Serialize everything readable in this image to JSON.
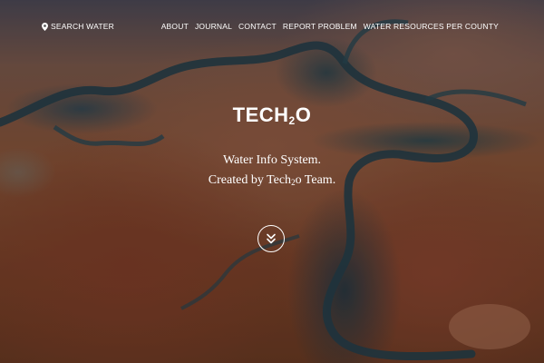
{
  "nav": {
    "search": {
      "icon": "location-pin-icon",
      "label": "SEARCH WATER"
    },
    "menu": [
      {
        "label": "ABOUT"
      },
      {
        "label": "JOURNAL"
      },
      {
        "label": "CONTACT"
      },
      {
        "label": "REPORT PROBLEM"
      },
      {
        "label": "WATER RESOURCES PER COUNTY"
      }
    ]
  },
  "hero": {
    "brand_main": "TECH",
    "brand_sub": "2",
    "brand_end": "O",
    "line1": "Water Info System.",
    "line2_pre": "Created by Tech",
    "line2_sub": "2",
    "line2_post": "o Team.",
    "scroll_icon": "double-chevron-down-icon"
  },
  "colors": {
    "text": "#ffffff",
    "river": "#1f3f4c",
    "canyon": "#8a5538"
  }
}
